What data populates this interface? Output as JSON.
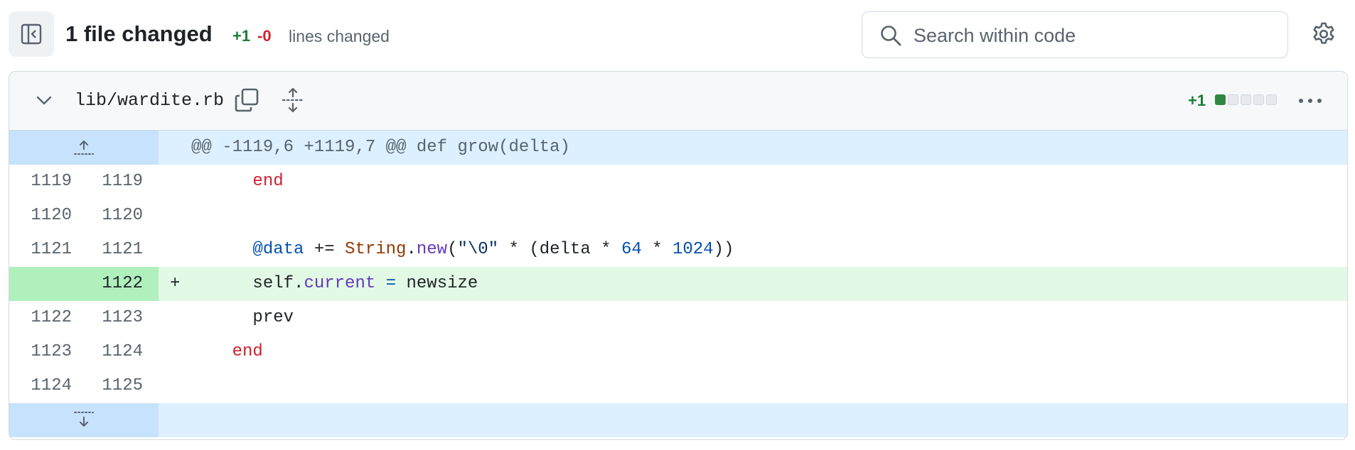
{
  "header": {
    "title": "1 file changed",
    "additions": "+1",
    "deletions": "-0",
    "lines_changed_label": "lines changed",
    "search_placeholder": "Search within code"
  },
  "file": {
    "name": "lib/wardite.rb",
    "diffstat_label": "+1",
    "diffstat_blocks": [
      "add",
      "neutral",
      "neutral",
      "neutral",
      "neutral"
    ]
  },
  "hunk": {
    "header": "@@ -1119,6 +1119,7 @@ def grow(delta)"
  },
  "lines": [
    {
      "old": "1119",
      "new": "1119",
      "type": "context",
      "marker": "",
      "indent": "      ",
      "tokens": [
        {
          "t": "end",
          "c": "kw"
        }
      ]
    },
    {
      "old": "1120",
      "new": "1120",
      "type": "context",
      "marker": "",
      "indent": "",
      "tokens": []
    },
    {
      "old": "1121",
      "new": "1121",
      "type": "context",
      "marker": "",
      "indent": "      ",
      "tokens": [
        {
          "t": "@data",
          "c": "ivar"
        },
        {
          "t": " += ",
          "c": ""
        },
        {
          "t": "String",
          "c": "const"
        },
        {
          "t": ".",
          "c": ""
        },
        {
          "t": "new",
          "c": "meth"
        },
        {
          "t": "(",
          "c": ""
        },
        {
          "t": "\"\\0\"",
          "c": "str"
        },
        {
          "t": " * (delta * ",
          "c": ""
        },
        {
          "t": "64",
          "c": "num"
        },
        {
          "t": " * ",
          "c": ""
        },
        {
          "t": "1024",
          "c": "num"
        },
        {
          "t": "))",
          "c": ""
        }
      ]
    },
    {
      "old": "",
      "new": "1122",
      "type": "add",
      "marker": "+",
      "indent": "      ",
      "tokens": [
        {
          "t": "self.",
          "c": ""
        },
        {
          "t": "current",
          "c": "meth"
        },
        {
          "t": " ",
          "c": ""
        },
        {
          "t": "=",
          "c": "ivar"
        },
        {
          "t": " newsize",
          "c": ""
        }
      ]
    },
    {
      "old": "1122",
      "new": "1123",
      "type": "context",
      "marker": "",
      "indent": "      ",
      "tokens": [
        {
          "t": "prev",
          "c": ""
        }
      ]
    },
    {
      "old": "1123",
      "new": "1124",
      "type": "context",
      "marker": "",
      "indent": "    ",
      "tokens": [
        {
          "t": "end",
          "c": "kw"
        }
      ]
    },
    {
      "old": "1124",
      "new": "1125",
      "type": "context",
      "marker": "",
      "indent": "",
      "tokens": []
    }
  ],
  "colors": {
    "addition": "#1a7f37",
    "deletion": "#cf222e",
    "hunk_bg": "#ddf0ff",
    "add_bg": "#e2f9e5"
  }
}
